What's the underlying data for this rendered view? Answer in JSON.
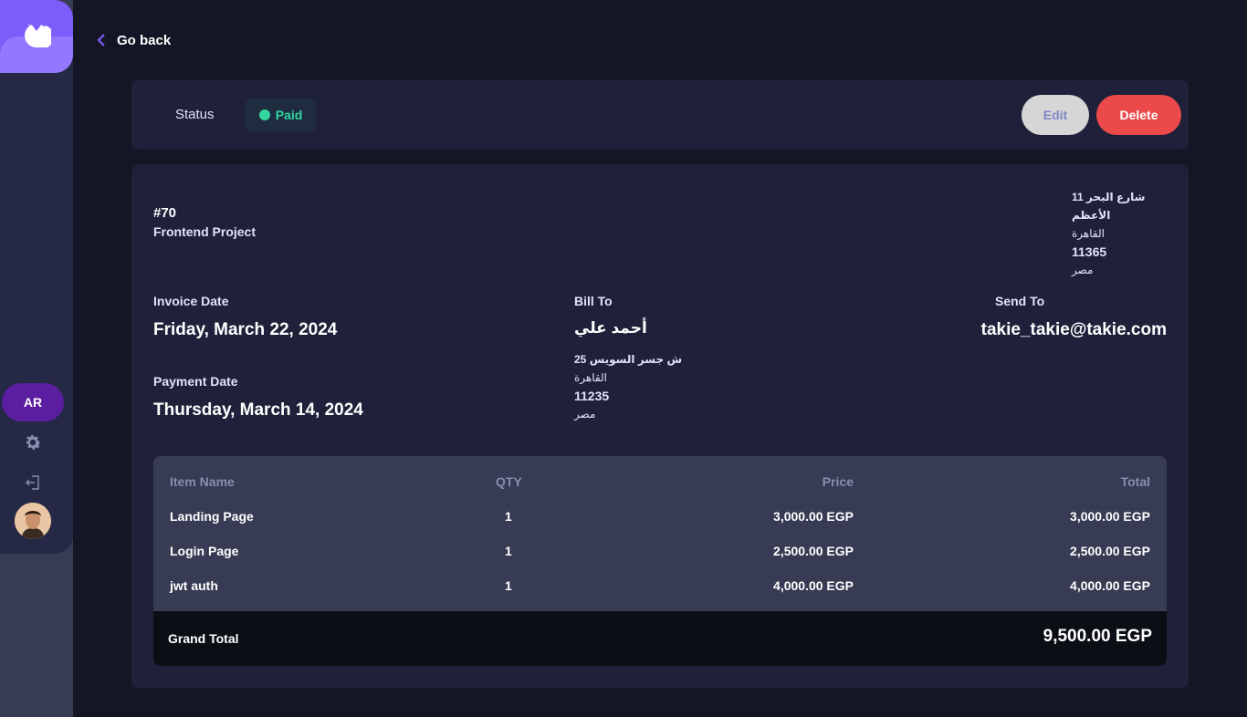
{
  "sidebar": {
    "lang_label": "AR"
  },
  "nav": {
    "go_back": "Go back"
  },
  "status": {
    "label": "Status",
    "value": "Paid",
    "color": "#33d69f"
  },
  "actions": {
    "edit": "Edit",
    "delete": "Delete"
  },
  "invoice": {
    "id": "#70",
    "description": "Frontend Project",
    "sender_address": [
      "11 شارع البحر الأعظم",
      "القاهرة",
      "11365",
      "مصر"
    ],
    "invoice_date_label": "Invoice Date",
    "invoice_date": "Friday, March 22, 2024",
    "payment_date_label": "Payment Date",
    "payment_date": "Thursday, March 14, 2024",
    "bill_to_label": "Bill To",
    "client_name": "أحمد علي",
    "client_address": [
      "25 ش جسر السويس",
      "القاهرة",
      "11235",
      "مصر"
    ],
    "send_to_label": "Send To",
    "client_email": "takie_takie@takie.com"
  },
  "items": {
    "headers": {
      "name": "Item Name",
      "qty": "QTY",
      "price": "Price",
      "total": "Total"
    },
    "rows": [
      {
        "name": "Landing Page",
        "qty": "1",
        "price": "3,000.00 EGP",
        "total": "3,000.00 EGP"
      },
      {
        "name": "Login Page",
        "qty": "1",
        "price": "2,500.00 EGP",
        "total": "2,500.00 EGP"
      },
      {
        "name": "jwt auth",
        "qty": "1",
        "price": "4,000.00 EGP",
        "total": "4,000.00 EGP"
      }
    ],
    "grand_total_label": "Grand Total",
    "grand_total": "9,500.00 EGP"
  },
  "colors": {
    "accent": "#7c5dfa",
    "delete": "#ec4a4a",
    "lang_button": "#5b1ea0"
  }
}
